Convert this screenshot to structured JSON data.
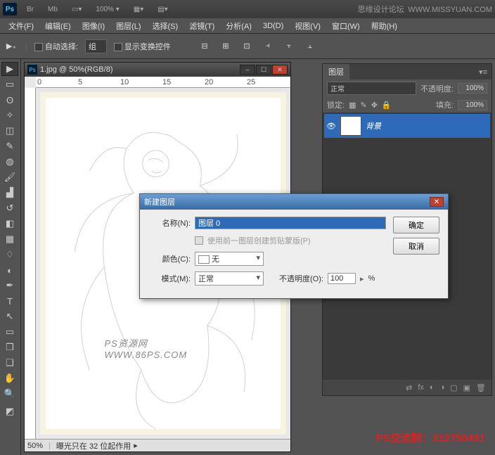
{
  "title": {
    "forum": "思缘设计论坛",
    "url": "WWW.MISSYUAN.COM",
    "zoom_indicator": "100% ▾"
  },
  "menu": {
    "file": "文件(F)",
    "edit": "编辑(E)",
    "image": "图像(I)",
    "layer": "图层(L)",
    "select": "选择(S)",
    "filter": "滤镜(T)",
    "analysis": "分析(A)",
    "3d": "3D(D)",
    "view": "视图(V)",
    "window": "窗口(W)",
    "help": "帮助(H)"
  },
  "options": {
    "autoselect": "自动选择:",
    "grouplabel": "组",
    "transform": "显示变换控件"
  },
  "doc": {
    "title": "1.jpg @ 50%(RGB/8)",
    "zoom": "50%",
    "status": "曝光只在 32 位起作用",
    "watermark": "PS资源网  WWW.86PS.COM"
  },
  "layers_panel": {
    "tab": "图层",
    "blend": "正常",
    "opacity_lbl": "不透明度:",
    "opacity": "100%",
    "lock_lbl": "锁定:",
    "fill_lbl": "填充:",
    "fill": "100%",
    "layer0": {
      "name": "背景"
    }
  },
  "dialog": {
    "title": "新建图层",
    "name_lbl": "名称(N):",
    "name_val": "图层 0",
    "clip_lbl": "使用前一图层创建剪贴蒙版(P)",
    "color_lbl": "颜色(C):",
    "color_val": "无",
    "mode_lbl": "模式(M):",
    "mode_val": "正常",
    "opacity_lbl": "不透明度(O):",
    "opacity_val": "100",
    "pct": "%",
    "ok": "确定",
    "cancel": "取消"
  },
  "ruler": {
    "r0": "0",
    "r5": "5",
    "r10": "10",
    "r15": "15",
    "r20": "20",
    "r25": "25"
  },
  "promo": "PS交流群：312750491"
}
